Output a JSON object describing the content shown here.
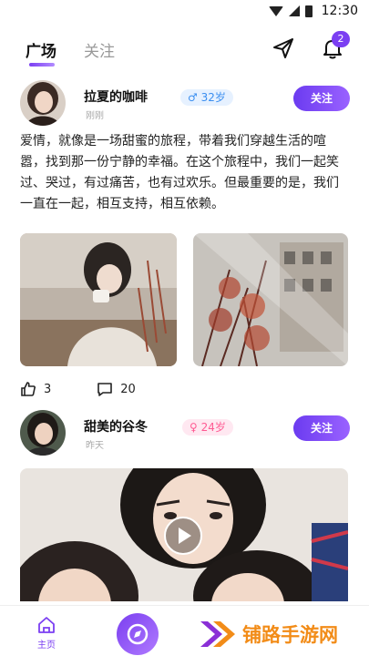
{
  "status_bar": {
    "time": "12:30"
  },
  "header": {
    "tabs": [
      {
        "label": "广场",
        "active": true
      },
      {
        "label": "关注",
        "active": false
      }
    ],
    "notification_count": "2",
    "icons": [
      "send-icon",
      "bell-icon"
    ]
  },
  "posts": [
    {
      "username": "拉夏的咖啡",
      "time": "刚刚",
      "gender": "male",
      "age": "♂ 32岁",
      "follow_label": "关注",
      "text": "爱情，就像是一场甜蜜的旅程，带着我们穿越生活的喧嚣，找到那一份宁静的幸福。在这个旅程中，我们一起笑过、哭过，有过痛苦，也有过欢乐。但最重要的是，我们一直在一起，相互支持，相互依赖。",
      "likes": "3",
      "comments": "20"
    },
    {
      "username": "甜美的谷冬",
      "time": "昨天",
      "gender": "female",
      "age": "♀ 24岁",
      "follow_label": "关注"
    }
  ],
  "bottom_nav": {
    "home_label": "主页"
  },
  "watermark": {
    "text": "铺路手游网"
  },
  "colors": {
    "accent": "#7b3ff2",
    "male": "#3a8ef0",
    "female": "#ff5a93",
    "watermark": "#f28c18"
  }
}
